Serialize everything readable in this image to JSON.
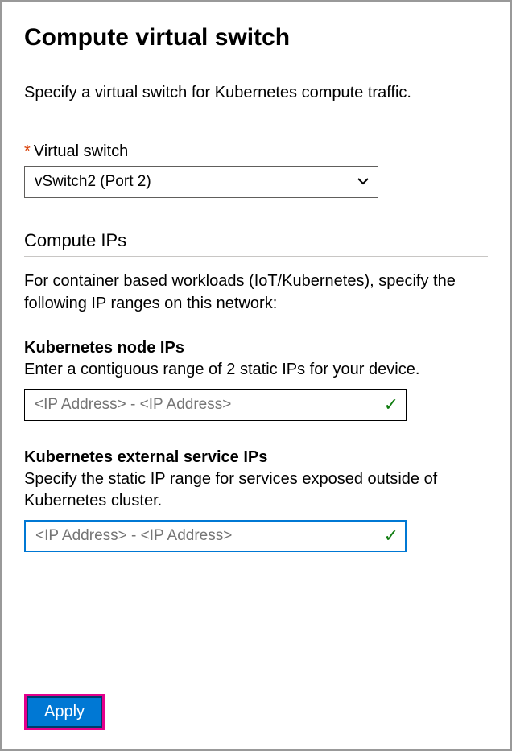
{
  "header": {
    "title": "Compute virtual switch",
    "subtitle": "Specify a virtual switch for Kubernetes compute traffic."
  },
  "virtual_switch": {
    "label": "Virtual switch",
    "required_mark": "*",
    "value": "vSwitch2 (Port 2)"
  },
  "compute_ips": {
    "section_title": "Compute IPs",
    "description": "For container based workloads (IoT/Kubernetes), specify the following IP ranges on this network:"
  },
  "node_ips": {
    "label": "Kubernetes node IPs",
    "description": "Enter a contiguous range of 2 static IPs for your device.",
    "placeholder": "<IP Address> - <IP Address>"
  },
  "service_ips": {
    "label": "Kubernetes external service IPs",
    "description": "Specify the static IP range for services exposed outside of Kubernetes cluster.",
    "placeholder": "<IP Address> - <IP Address>"
  },
  "footer": {
    "apply_label": "Apply"
  }
}
